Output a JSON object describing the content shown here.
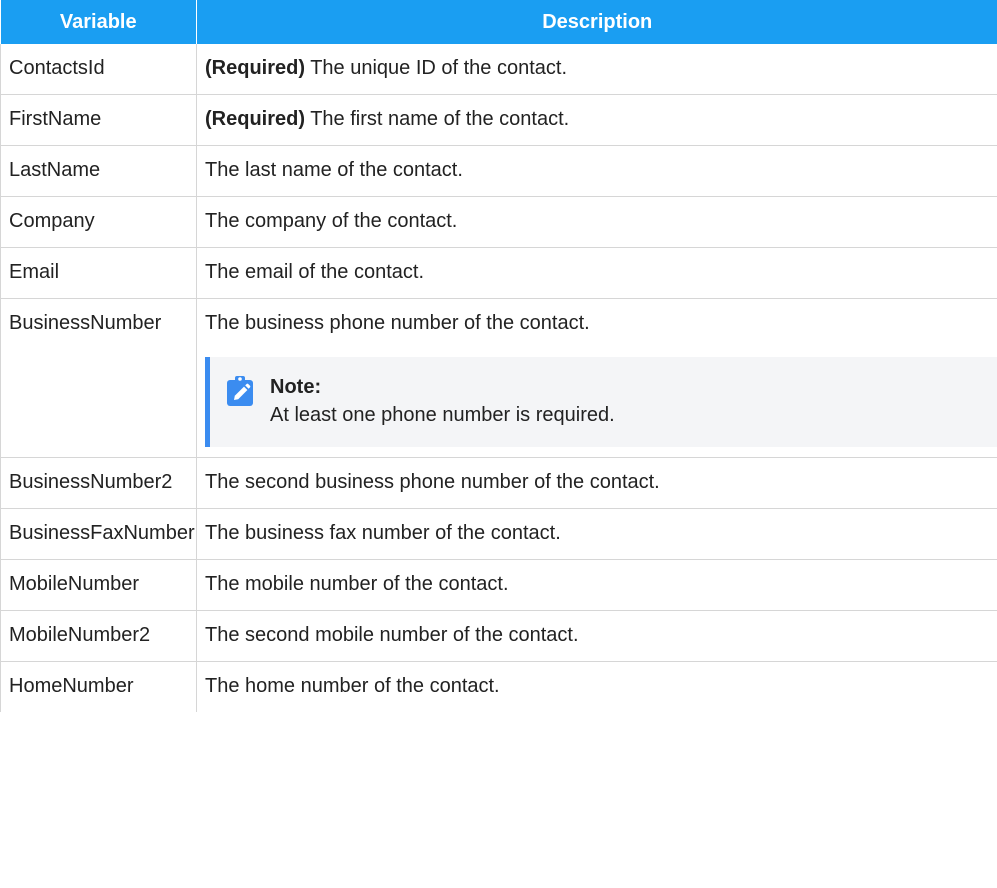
{
  "headers": {
    "variable": "Variable",
    "description": "Description"
  },
  "rows": [
    {
      "variable": "ContactsId",
      "required": "(Required)",
      "description": " The unique ID of the contact."
    },
    {
      "variable": "FirstName",
      "required": "(Required)",
      "description": " The first name of the contact."
    },
    {
      "variable": "LastName",
      "description": "The last name of the contact."
    },
    {
      "variable": "Company",
      "description": "The company of the contact."
    },
    {
      "variable": "Email",
      "description": "The email of the contact."
    },
    {
      "variable": "BusinessNumber",
      "description": "The business phone number of the contact.",
      "note": {
        "title": "Note:",
        "text": "At least one phone number is required."
      }
    },
    {
      "variable": "BusinessNumber2",
      "description": "The second business phone number of the contact."
    },
    {
      "variable": "BusinessFaxNumber",
      "description": "The business fax number of the contact."
    },
    {
      "variable": "MobileNumber",
      "description": "The mobile number of the contact."
    },
    {
      "variable": "MobileNumber2",
      "description": "The second mobile number of the contact."
    },
    {
      "variable": "HomeNumber",
      "description": "The home number of the contact."
    }
  ],
  "colors": {
    "header_bg": "#1a9ef2",
    "note_accent": "#3b8cf0",
    "note_bg": "#f4f5f7",
    "border": "#d6d6d6"
  },
  "icons": {
    "note": "pencil-clipboard-icon"
  }
}
